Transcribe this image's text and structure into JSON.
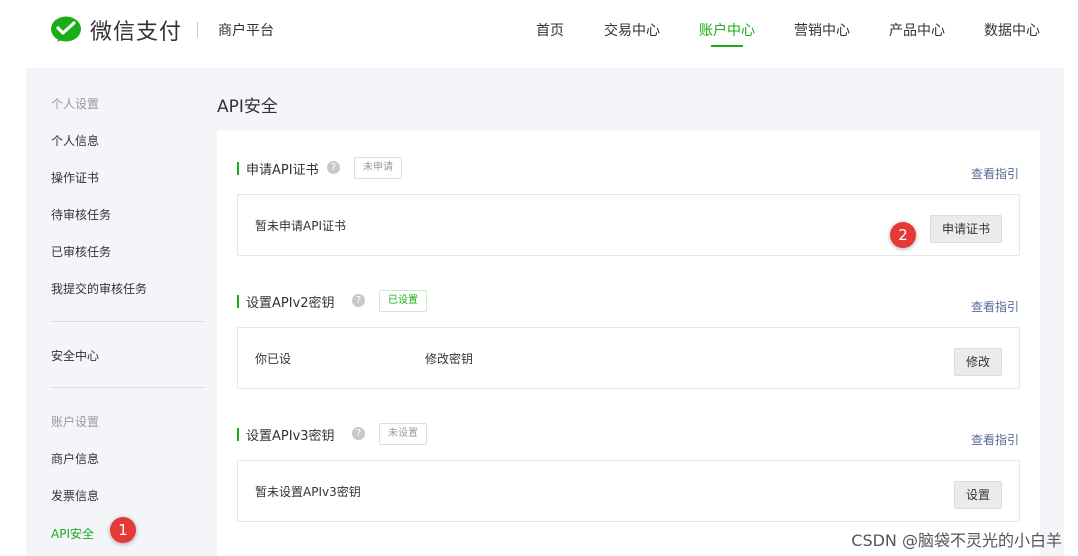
{
  "header": {
    "brand": "微信支付",
    "platform": "商户平台",
    "nav": [
      {
        "label": "首页"
      },
      {
        "label": "交易中心"
      },
      {
        "label": "账户中心"
      },
      {
        "label": "营销中心"
      },
      {
        "label": "产品中心"
      },
      {
        "label": "数据中心"
      }
    ],
    "active_nav": "账户中心"
  },
  "sidebar": {
    "group1": "个人设置",
    "items1": [
      "个人信息",
      "操作证书",
      "待审核任务",
      "已审核任务",
      "我提交的审核任务"
    ],
    "security": "安全中心",
    "group2": "账户设置",
    "items2": [
      "商户信息",
      "发票信息",
      "API安全"
    ],
    "active_item": "API安全"
  },
  "main": {
    "title": "API安全",
    "sections": [
      {
        "title": "申请API证书",
        "status": "未申请",
        "guide": "查看指引",
        "text": "暂未申请API证书",
        "text2": "",
        "button": "申请证书"
      },
      {
        "title": "设置APIv2密钥",
        "status": "已设置",
        "guide": "查看指引",
        "text": "你已设",
        "text2": "修改密钥",
        "button": "修改"
      },
      {
        "title": "设置APIv3密钥",
        "status": "未设置",
        "guide": "查看指引",
        "text": "暂未设置APIv3密钥",
        "text2": "",
        "button": "设置"
      }
    ]
  },
  "annotations": [
    "1",
    "2"
  ],
  "watermark": "CSDN @脑袋不灵光的小白羊",
  "colors": {
    "accent": "#1aad19",
    "link": "#576b95",
    "badge": "#e53935"
  }
}
